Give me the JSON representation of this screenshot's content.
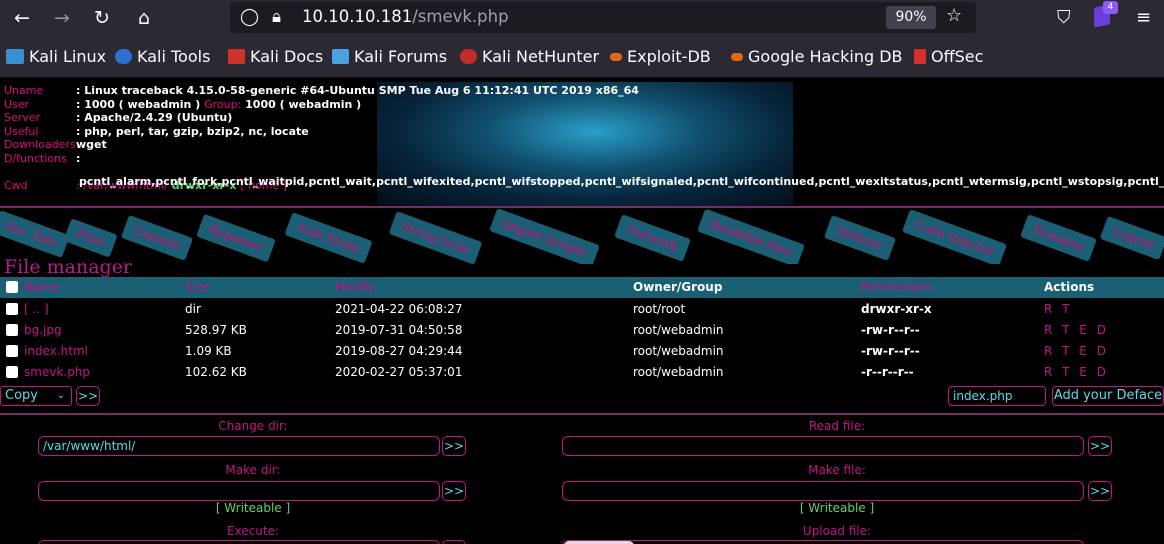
{
  "browser": {
    "url_host": "10.10.10.181",
    "url_path": "/smevk.php",
    "zoom": "90%",
    "extension_badge": "4",
    "icons": [
      "back-icon",
      "forward-icon",
      "reload-icon",
      "home-icon",
      "shield-icon",
      "lock-icon",
      "star-icon",
      "pocket-icon",
      "menu-icon"
    ]
  },
  "bookmarks": [
    {
      "label": "Kali Linux",
      "color": "#3b8fd1"
    },
    {
      "label": "Kali Tools",
      "color": "#2f6fcf"
    },
    {
      "label": "Kali Docs",
      "color": "#d0332c"
    },
    {
      "label": "Kali Forums",
      "color": "#4aa0e0"
    },
    {
      "label": "Kali NetHunter",
      "color": "#c42b2b"
    },
    {
      "label": "Exploit-DB",
      "color": "#e06a1a"
    },
    {
      "label": "Google Hacking DB",
      "color": "#e06a1a"
    },
    {
      "label": "OffSec",
      "color": "#d83030"
    }
  ],
  "sysinfo": {
    "uname_label": "Uname",
    "uname": ": Linux traceback 4.15.0-58-generic #64-Ubuntu SMP Tue Aug 6 11:12:41 UTC 2019 x86_64",
    "user_label": "User",
    "user": ": 1000 ( webadmin )",
    "group_label": "Group:",
    "group": "1000 ( webadmin )",
    "server_label": "Server",
    "server": ": Apache/2.4.29 (Ubuntu)",
    "useful_label": "Useful",
    "useful": ": php, perl, tar, gzip, bzip2, nc, locate",
    "downloaders_label": "Downloaders:",
    "downloaders": "wget",
    "dfunctions_label": "D/functions",
    "dfunctions_sep": ":",
    "dfunctions": "pcntl_alarm,pcntl_fork,pcntl_waitpid,pcntl_wait,pcntl_wifexited,pcntl_wifstopped,pcntl_wifsignaled,pcntl_wifcontinued,pcntl_wexitstatus,pcntl_wtermsig,pcntl_wstopsig,pcntl_signal,pcntl",
    "cwd_label": "Cwd",
    "cwd": ": /var/www/html/",
    "cwd_perm": "drwxr-xr-x",
    "cwd_home": "[ home ]"
  },
  "tabs": [
    "Sec. Info",
    "Files",
    "Console",
    "Bypasser",
    "Safe Mode",
    "String tools",
    "Import Scripts",
    "Network",
    "Readable Dirs",
    "Defacer",
    "Code Injector",
    "Domains",
    "Logout"
  ],
  "file_manager": {
    "title": "File manager",
    "headers": {
      "name": "Name",
      "size": "Size",
      "modify": "Modify",
      "owner": "Owner/Group",
      "permissions": "Permissions",
      "actions": "Actions"
    },
    "rows": [
      {
        "name": "[ .. ]",
        "size": "dir",
        "modify": "2021-04-22 06:08:27",
        "owner": "root/root",
        "perm": "drwxr-xr-x",
        "actions": "R T"
      },
      {
        "name": "bg.jpg",
        "size": "528.97 KB",
        "modify": "2019-07-31 04:50:58",
        "owner": "root/webadmin",
        "perm": "-rw-r--r--",
        "actions": "R T E D"
      },
      {
        "name": "index.html",
        "size": "1.09 KB",
        "modify": "2019-08-27 04:29:44",
        "owner": "root/webadmin",
        "perm": "-rw-r--r--",
        "actions": "R T E D"
      },
      {
        "name": "smevk.php",
        "size": "102.62 KB",
        "modify": "2020-02-27 05:37:01",
        "owner": "root/webadmin",
        "perm": "-r--r--r--",
        "actions": "R T E D"
      }
    ],
    "action_select": "Copy",
    "go_label": ">>",
    "deface_file": "index.php",
    "deface_button": "Add your Deface"
  },
  "forms": {
    "change_dir_label": "Change dir:",
    "change_dir_value": "/var/www/html/",
    "read_file_label": "Read file:",
    "read_file_value": "",
    "make_dir_label": "Make dir:",
    "make_file_label": "Make file:",
    "writeable": "[ Writeable ]",
    "execute_label": "Execute:",
    "upload_label": "Upload file:",
    "go": ">>"
  }
}
